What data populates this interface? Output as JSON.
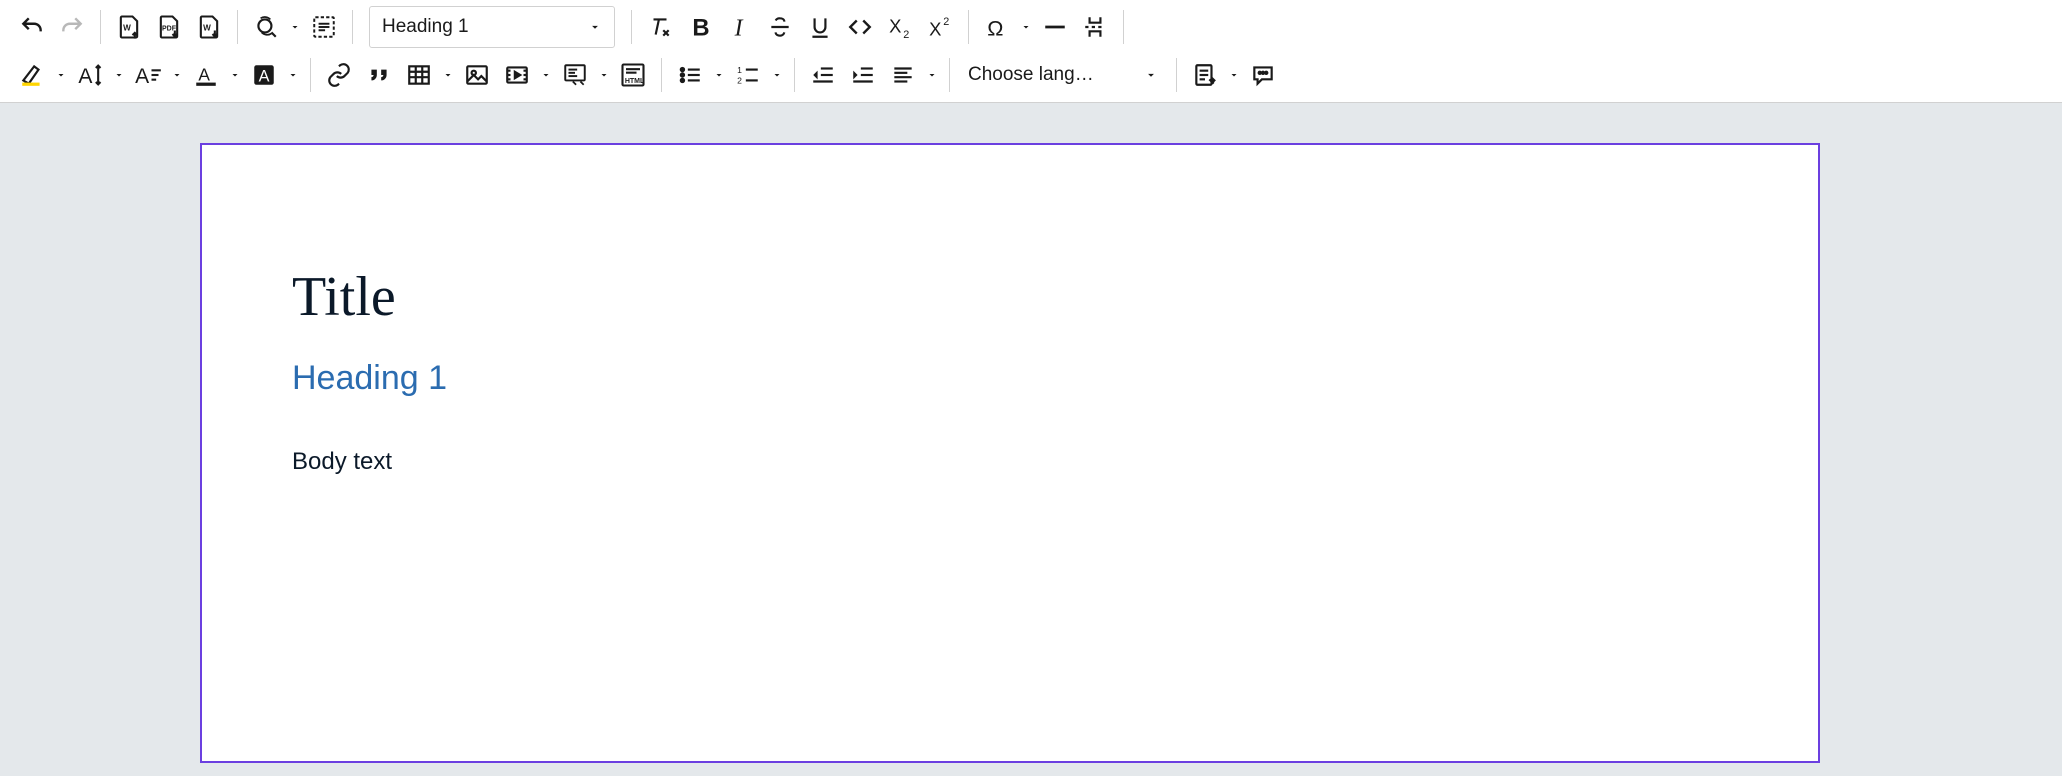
{
  "toolbar": {
    "heading_select": "Heading 1",
    "lang_select": "Choose lang…"
  },
  "document": {
    "title": "Title",
    "heading1": "Heading 1",
    "body": "Body text"
  }
}
